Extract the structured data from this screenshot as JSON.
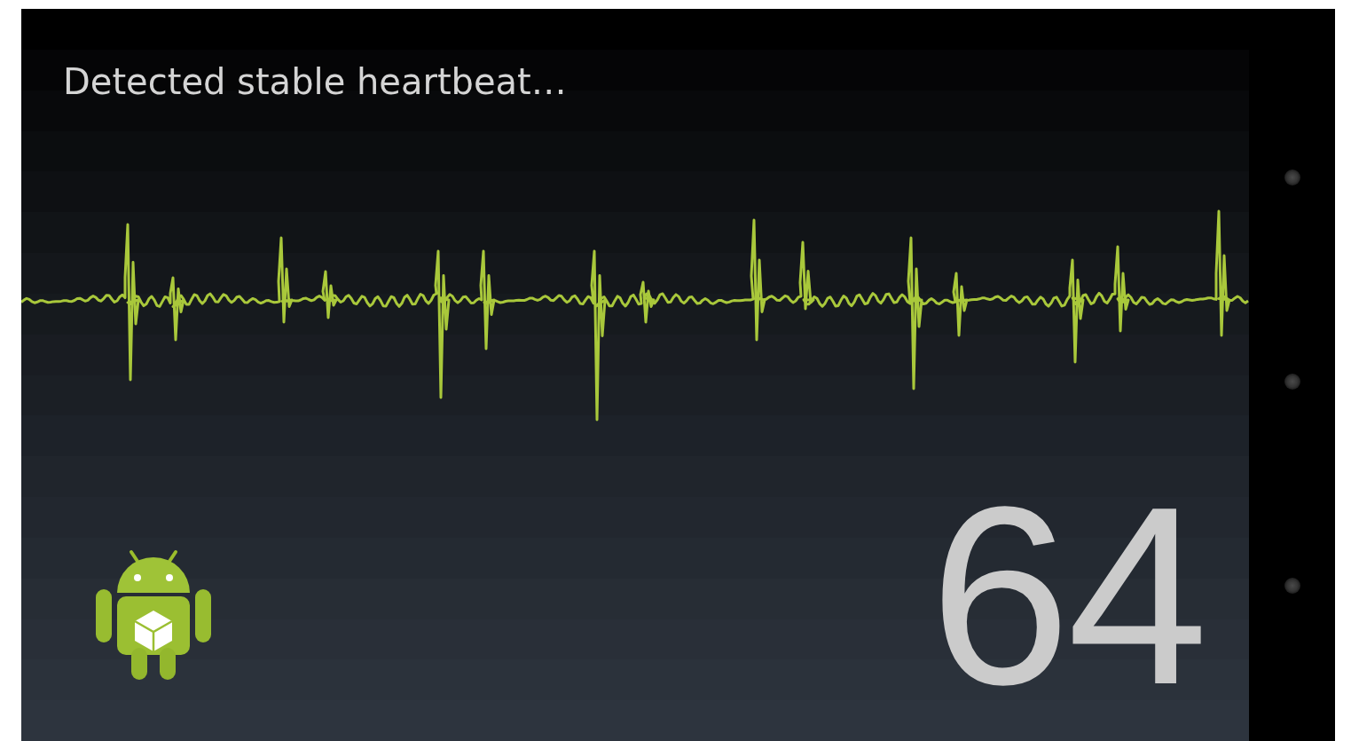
{
  "status": {
    "text": "Detected stable heartbeat…"
  },
  "heart_rate": {
    "value": "64"
  }
}
